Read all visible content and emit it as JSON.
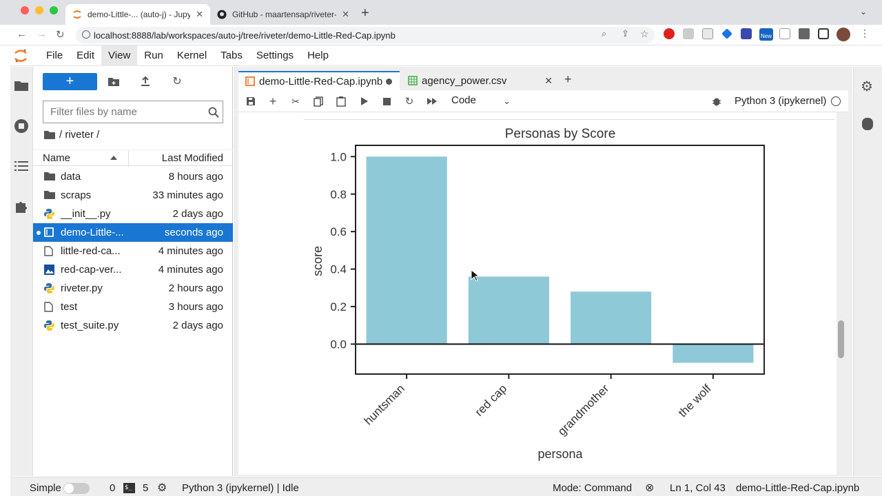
{
  "browser": {
    "tabs": [
      {
        "title": "demo-Little-... (auto-j) - Jupyter"
      },
      {
        "title": "GitHub - maartensap/riveter-nlp"
      }
    ],
    "url": "localhost:8888/lab/workspaces/auto-j/tree/riveter/demo-Little-Red-Cap.ipynb",
    "extension_badge": "New"
  },
  "menubar": {
    "items": [
      "File",
      "Edit",
      "View",
      "Run",
      "Kernel",
      "Tabs",
      "Settings",
      "Help"
    ]
  },
  "filebrowser": {
    "new_button": "+",
    "filter_placeholder": "Filter files by name",
    "breadcrumb": "/ riveter /",
    "col_name": "Name",
    "col_modified": "Last Modified",
    "files": [
      {
        "name": "data",
        "modified": "8 hours ago",
        "type": "folder"
      },
      {
        "name": "scraps",
        "modified": "33 minutes ago",
        "type": "folder"
      },
      {
        "name": "__init__.py",
        "modified": "2 days ago",
        "type": "python"
      },
      {
        "name": "demo-Little-...",
        "modified": "seconds ago",
        "type": "notebook",
        "selected": true
      },
      {
        "name": "little-red-ca...",
        "modified": "4 minutes ago",
        "type": "file"
      },
      {
        "name": "red-cap-ver...",
        "modified": "4 minutes ago",
        "type": "image"
      },
      {
        "name": "riveter.py",
        "modified": "2 hours ago",
        "type": "python"
      },
      {
        "name": "test",
        "modified": "3 hours ago",
        "type": "file"
      },
      {
        "name": "test_suite.py",
        "modified": "2 days ago",
        "type": "python"
      }
    ]
  },
  "notebook": {
    "tabs": [
      {
        "title": "demo-Little-Red-Cap.ipynb"
      },
      {
        "title": "agency_power.csv"
      }
    ],
    "cell_type": "Code",
    "kernel": "Python 3 (ipykernel)"
  },
  "chart_data": {
    "type": "bar",
    "title": "Personas by Score",
    "xlabel": "persona",
    "ylabel": "score",
    "categories": [
      "huntsman",
      "red cap",
      "grandmother",
      "the wolf"
    ],
    "values": [
      1.0,
      0.36,
      0.28,
      -0.1
    ],
    "ylim": [
      -0.16,
      1.06
    ],
    "yticks": [
      "0.0",
      "0.2",
      "0.4",
      "0.6",
      "0.8",
      "1.0"
    ],
    "color": "#8ec9d8",
    "grid": false
  },
  "status": {
    "mode_label": "Simple",
    "terminals": "0",
    "kernels": "5",
    "kernel_state": "Python 3 (ipykernel) | Idle",
    "mode": "Mode: Command",
    "position": "Ln 1, Col 43",
    "filename": "demo-Little-Red-Cap.ipynb"
  },
  "colors": {
    "accent": "#1976d2",
    "bar": "#8ec9d8",
    "jupyter_orange": "#f37726"
  }
}
